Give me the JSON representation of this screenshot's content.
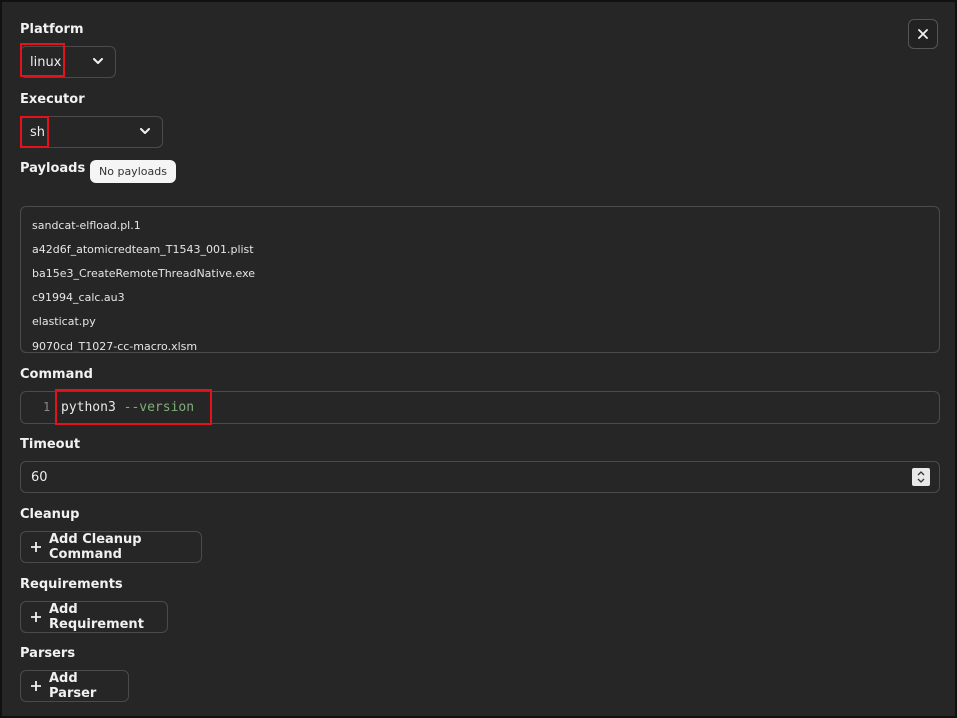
{
  "platform": {
    "label": "Platform",
    "value": "linux"
  },
  "executor": {
    "label": "Executor",
    "value": "sh"
  },
  "payloads": {
    "label": "Payloads",
    "badge": "No payloads",
    "items": [
      "sandcat-elfload.pl.1",
      "a42d6f_atomicredteam_T1543_001.plist",
      "ba15e3_CreateRemoteThreadNative.exe",
      "c91994_calc.au3",
      "elasticat.py",
      "9070cd_T1027-cc-macro.xlsm"
    ]
  },
  "command": {
    "label": "Command",
    "line_number": "1",
    "keyword": "python3",
    "argument": "--version"
  },
  "timeout": {
    "label": "Timeout",
    "value": "60"
  },
  "cleanup": {
    "label": "Cleanup",
    "button": "Add Cleanup Command"
  },
  "requirements": {
    "label": "Requirements",
    "button": "Add Requirement"
  },
  "parsers": {
    "label": "Parsers",
    "button": "Add Parser"
  },
  "icons": {
    "close": "close-icon",
    "chevron": "chevron-down-icon",
    "plus": "plus-icon",
    "spinner": "spinner-icon"
  },
  "colors": {
    "highlight": "#e3121b",
    "code_argument": "#7fae78",
    "background": "#262626"
  }
}
